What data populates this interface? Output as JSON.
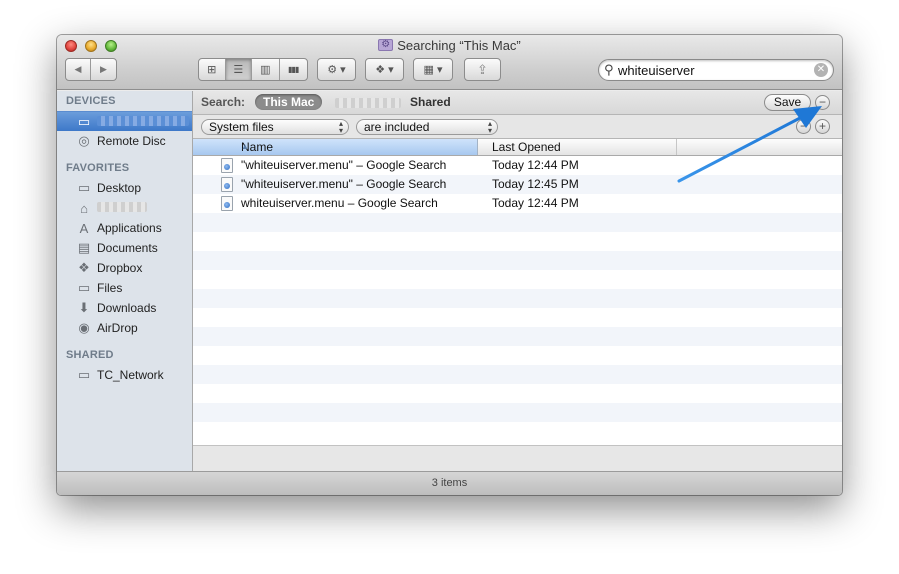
{
  "window": {
    "title": "Searching “This Mac”"
  },
  "toolbar": {
    "back_icon": "◀",
    "forward_icon": "▶",
    "view_icons": [
      "⊞",
      "☰",
      "▥",
      "▮▮▮"
    ],
    "action_icon": "⚙ ▾",
    "dropbox_icon": "❖ ▾",
    "arrange_icon": "▦ ▾",
    "share_icon": "⇪"
  },
  "search": {
    "value": "whiteuiserver",
    "clear_icon": "✕"
  },
  "sidebar": {
    "devices_header": "DEVICES",
    "devices": [
      {
        "label": "Remote Disc",
        "icon": "◎"
      }
    ],
    "favorites_header": "FAVORITES",
    "favorites": [
      {
        "label": "Desktop",
        "icon": "▭"
      },
      {
        "label": "Applications",
        "icon": "A"
      },
      {
        "label": "Documents",
        "icon": "▤"
      },
      {
        "label": "Dropbox",
        "icon": "❖"
      },
      {
        "label": "Files",
        "icon": "▭"
      },
      {
        "label": "Downloads",
        "icon": "⬇"
      },
      {
        "label": "AirDrop",
        "icon": "◉"
      }
    ],
    "shared_header": "SHARED",
    "shared": [
      {
        "label": "TC_Network",
        "icon": "▭"
      }
    ]
  },
  "scope": {
    "label": "Search:",
    "this_mac": "This Mac",
    "shared": "Shared",
    "save": "Save",
    "minus": "−",
    "plus": "+"
  },
  "criteria": {
    "attribute": "System files",
    "operator": "are included"
  },
  "columns": {
    "name": "Name",
    "last_opened": "Last Opened"
  },
  "results": [
    {
      "name": "\"whiteuiserver.menu\" – Google Search",
      "opened": "Today 12:44 PM"
    },
    {
      "name": "\"whiteuiserver.menu\" – Google Search",
      "opened": "Today 12:45 PM"
    },
    {
      "name": "whiteuiserver.menu – Google Search",
      "opened": "Today 12:44 PM"
    }
  ],
  "status": {
    "count": "3 items"
  },
  "colors": {
    "accent_selection": "#3d78c9",
    "annotation_arrow": "#2f8de4"
  }
}
